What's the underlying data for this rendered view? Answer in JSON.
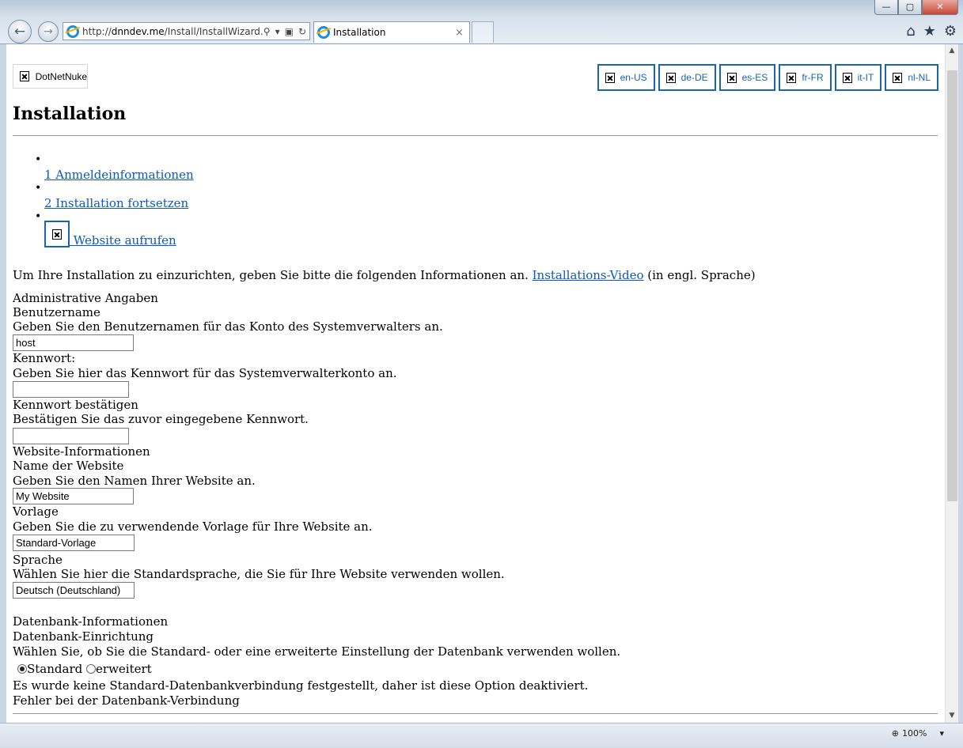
{
  "browser": {
    "url_prefix": "http://",
    "url_host": "dnndev.me",
    "url_path": "/Install/InstallWizard.as",
    "tab_title": "Installation",
    "tab_close": "×",
    "back": "←",
    "forward": "→",
    "search_icon": "⚲",
    "dropdown_icon": "▾",
    "compat_icon": "▣",
    "refresh_icon": "↻",
    "home_icon": "⌂",
    "favorites_icon": "★",
    "tools_icon": "⚙",
    "win_min": "—",
    "win_max": "▢",
    "win_close": "✕",
    "zoom": "100%",
    "zoom_icon": "⊕",
    "zoom_arrow": "▾"
  },
  "header": {
    "logo_alt": "DotNetNuke",
    "languages": [
      "en-US",
      "de-DE",
      "es-ES",
      "fr-FR",
      "it-IT",
      "nl-NL"
    ],
    "title": "Installation"
  },
  "steps": [
    {
      "label": "1 Anmeldeinformationen"
    },
    {
      "label": "2 Installation fortsetzen"
    },
    {
      "label": " Website aufrufen"
    }
  ],
  "intro": {
    "text_before": "Um Ihre Installation zu einzurichten, geben Sie bitte die folgenden Informationen an. ",
    "video_link": "Installations-Video",
    "text_after": " (in engl. Sprache)"
  },
  "admin": {
    "section": "Administrative Angaben",
    "username_label": "Benutzername",
    "username_help": "Geben Sie den Benutzernamen für das Konto des Systemverwalters an.",
    "username_value": "host",
    "password_label": "Kennwort:",
    "password_help": "Geben Sie hier das Kennwort für das Systemverwalterkonto an.",
    "password_value": "",
    "confirm_label": "Kennwort bestätigen",
    "confirm_help": "Bestätigen Sie das zuvor eingegebene Kennwort.",
    "confirm_value": ""
  },
  "website": {
    "section": "Website-Informationen",
    "name_label": "Name der Website",
    "name_help": "Geben Sie den Namen Ihrer Website an.",
    "name_value": "My Website",
    "template_label": "Vorlage",
    "template_help": "Geben Sie die zu verwendende Vorlage für Ihre Website an.",
    "template_value": "Standard-Vorlage",
    "language_label": "Sprache",
    "language_help": "Wählen Sie hier die Standardsprache, die Sie für Ihre Website verwenden wollen.",
    "language_value": "Deutsch (Deutschland)"
  },
  "database": {
    "section": "Datenbank-Informationen",
    "setup_label": "Datenbank-Einrichtung",
    "setup_help": "Wählen Sie, ob Sie die Standard- oder eine erweiterte Einstellung der Datenbank verwenden wollen.",
    "option_standard": "Standard",
    "option_advanced": "erweitert",
    "selected": "Standard",
    "no_connection_msg": "Es wurde keine Standard-Datenbankverbindung festgestellt, daher ist diese Option deaktiviert.",
    "error_msg": "Fehler bei der Datenbank-Verbindung"
  }
}
